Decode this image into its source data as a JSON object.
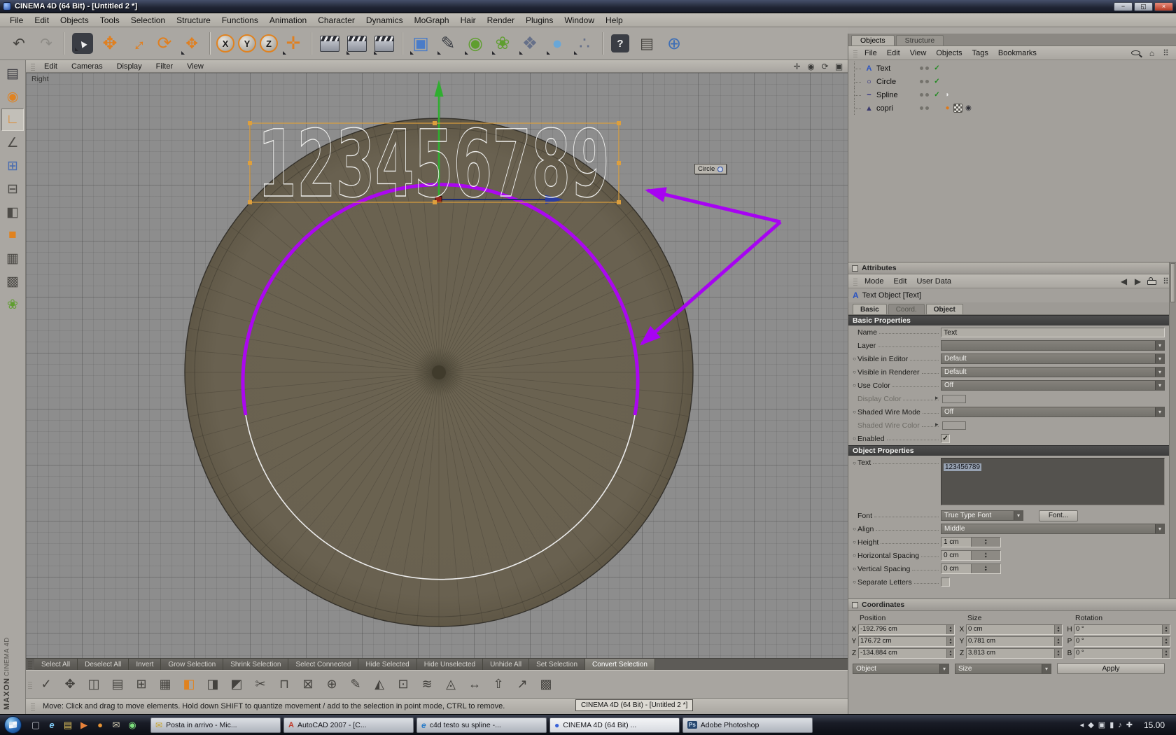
{
  "window": {
    "title": "CINEMA 4D (64 Bit) - [Untitled 2 *]",
    "minimize": "−",
    "maximize": "◱",
    "close": "×"
  },
  "menubar": {
    "items": [
      "File",
      "Edit",
      "Objects",
      "Tools",
      "Selection",
      "Structure",
      "Functions",
      "Animation",
      "Character",
      "Dynamics",
      "MoGraph",
      "Hair",
      "Render",
      "Plugins",
      "Window",
      "Help"
    ]
  },
  "toolbar": {
    "icons": [
      {
        "name": "undo-icon",
        "glyph": "↶",
        "cls": "t-plain"
      },
      {
        "name": "redo-icon",
        "glyph": "↷",
        "cls": "t-plain t-dim"
      },
      {
        "name": "toolbar-separator",
        "glyph": "",
        "cls": "t-sep"
      },
      {
        "name": "live-selection-icon",
        "glyph": "▲",
        "cls": "t-round t-fly"
      },
      {
        "name": "move-tool-icon",
        "glyph": "✥",
        "cls": "t-orange t-big"
      },
      {
        "name": "scale-tool-icon",
        "glyph": "↔",
        "cls": "t-orange t-big t-rot"
      },
      {
        "name": "rotate-tool-icon",
        "glyph": "⟳",
        "cls": "t-orange t-big"
      },
      {
        "name": "active-tool-icon",
        "glyph": "✥",
        "cls": "t-orange t-fly"
      },
      {
        "name": "toolbar-separator",
        "glyph": "",
        "cls": "t-sep"
      },
      {
        "name": "lock-x-axis-icon",
        "glyph": "X",
        "cls": "t-axis"
      },
      {
        "name": "lock-y-axis-icon",
        "glyph": "Y",
        "cls": "t-axis"
      },
      {
        "name": "lock-z-axis-icon",
        "glyph": "Z",
        "cls": "t-axis"
      },
      {
        "name": "coordinate-system-icon",
        "glyph": "✛",
        "cls": "t-orange t-big t-fly"
      },
      {
        "name": "toolbar-separator",
        "glyph": "",
        "cls": "t-sep"
      },
      {
        "name": "render-view-icon",
        "glyph": "",
        "cls": "t-clap"
      },
      {
        "name": "render-picture-viewer-icon",
        "glyph": "",
        "cls": "t-clap t-fly"
      },
      {
        "name": "render-settings-icon",
        "glyph": "",
        "cls": "t-clap t-fly"
      },
      {
        "name": "toolbar-separator",
        "glyph": "",
        "cls": "t-sep"
      },
      {
        "name": "add-cube-icon",
        "glyph": "▣",
        "cls": "t-blue t-big t-fly"
      },
      {
        "name": "add-spline-icon",
        "glyph": "✎",
        "cls": "t-pen t-big t-fly"
      },
      {
        "name": "add-nurbs-icon",
        "glyph": "◉",
        "cls": "t-green t-big t-fly"
      },
      {
        "name": "add-modeling-icon",
        "glyph": "❀",
        "cls": "t-green t-big t-fly"
      },
      {
        "name": "add-deformer-icon",
        "glyph": "❖",
        "cls": "t-slate t-big t-fly"
      },
      {
        "name": "add-environment-icon",
        "glyph": "●",
        "cls": "t-sky t-big t-fly"
      },
      {
        "name": "add-particles-icon",
        "glyph": "∴",
        "cls": "t-slate t-big t-fly"
      },
      {
        "name": "toolbar-separator",
        "glyph": "",
        "cls": "t-sep"
      },
      {
        "name": "help-icon",
        "glyph": "?",
        "cls": "t-help"
      },
      {
        "name": "tablet-icon",
        "glyph": "▤",
        "cls": "t-plain"
      },
      {
        "name": "browser-icon",
        "glyph": "⊕",
        "cls": "t-globe"
      }
    ]
  },
  "left_palette": {
    "icons": [
      {
        "name": "display-filter-icon",
        "glyph": "▤",
        "cls": "c-dark"
      },
      {
        "name": "object-mode-icon",
        "glyph": "◉",
        "cls": "c-orange"
      },
      {
        "name": "model-mode-icon",
        "glyph": "∟",
        "cls": "c-orange p-active"
      },
      {
        "name": "object-axis-mode-icon",
        "glyph": "∠",
        "cls": "c-gray"
      },
      {
        "name": "point-mode-icon",
        "glyph": "⊞",
        "cls": "c-blue"
      },
      {
        "name": "edge-mode-icon",
        "glyph": "⊟",
        "cls": "c-gray"
      },
      {
        "name": "polygon-mode-icon",
        "glyph": "◧",
        "cls": "c-gray"
      },
      {
        "name": "texture-mode-icon",
        "glyph": "■",
        "cls": "c-orange"
      },
      {
        "name": "texture-axis-mode-icon",
        "glyph": "▦",
        "cls": "c-gray"
      },
      {
        "name": "workplane-icon",
        "glyph": "▩",
        "cls": "c-gray"
      },
      {
        "name": "kinematics-icon",
        "glyph": "❀",
        "cls": "c-green"
      }
    ]
  },
  "branding": {
    "line1": "MAXON",
    "line2": "CINEMA 4D"
  },
  "viewport": {
    "menu": [
      "Edit",
      "Cameras",
      "Display",
      "Filter",
      "View"
    ],
    "corner_icons": [
      {
        "name": "pan-view-icon",
        "glyph": "✛",
        "cls": ""
      },
      {
        "name": "zoom-view-icon",
        "glyph": "◉",
        "cls": ""
      },
      {
        "name": "rotate-view-icon",
        "glyph": "⟳",
        "cls": ""
      },
      {
        "name": "toggle-view-icon",
        "glyph": "▣",
        "cls": ""
      }
    ],
    "view_label": "Right",
    "spline_text": "123456789",
    "tooltip": {
      "label": "Circle"
    }
  },
  "object_manager": {
    "tabs": [
      {
        "name": "tab-objects",
        "label": "Objects",
        "cls": "on"
      },
      {
        "name": "tab-structure",
        "label": "Structure",
        "cls": ""
      }
    ],
    "menu": [
      "File",
      "Edit",
      "View",
      "Objects",
      "Tags",
      "Bookmarks"
    ],
    "corner_icons": [
      {
        "name": "search-icon",
        "glyph": "",
        "cls": "css-search"
      },
      {
        "name": "home-icon",
        "glyph": "⌂",
        "cls": ""
      },
      {
        "name": "panel-menu-icon",
        "glyph": "⠿",
        "cls": ""
      }
    ],
    "objects": [
      {
        "name": "Text",
        "icon_name": "text-spline-icon",
        "icon": "ico-text",
        "ig": "A",
        "check": "✓"
      },
      {
        "name": "Circle",
        "icon_name": "circle-spline-icon",
        "icon": "ico-circle",
        "ig": "○",
        "check": "✓"
      },
      {
        "name": "Spline",
        "icon_name": "spline-icon",
        "icon": "ico-spline",
        "ig": "~",
        "check": "✓",
        "tag1": "◗",
        "tag1c": "tag-white"
      },
      {
        "name": "copri",
        "icon_name": "polygon-object-icon",
        "icon": "ico-poly",
        "ig": "▲",
        "check": "",
        "tag1": "●",
        "tag1c": "tag-orange",
        "tag2": "",
        "tag2c": "tag-checker",
        "tag3": "◉",
        "tag3c": "tag-dark"
      }
    ]
  },
  "attributes": {
    "panel_title": "Attributes",
    "menu": [
      "Mode",
      "Edit",
      "User Data"
    ],
    "nav_icons": [
      {
        "name": "prev-object-icon",
        "glyph": "◀",
        "cls": ""
      },
      {
        "name": "next-object-icon",
        "glyph": "▶",
        "cls": ""
      },
      {
        "name": "lock-icon",
        "glyph": "",
        "cls": "css-lock"
      },
      {
        "name": "panel-menu-icon",
        "glyph": "⠿",
        "cls": ""
      }
    ],
    "object_header": {
      "icon": "A",
      "title": "Text Object [Text]"
    },
    "tabs": [
      {
        "name": "tab-basic",
        "label": "Basic",
        "cls": "on"
      },
      {
        "name": "tab-coord",
        "label": "Coord.",
        "cls": "dim"
      },
      {
        "name": "tab-object",
        "label": "Object",
        "cls": "on"
      }
    ],
    "sections": {
      "basic": "Basic Properties",
      "object": "Object Properties"
    },
    "basic_rows": [
      {
        "type": "text",
        "label": "Name",
        "value": "Text"
      },
      {
        "type": "dd",
        "label": "Layer",
        "value": ""
      },
      {
        "type": "dd",
        "label": "Visible in Editor",
        "value": "Default",
        "dotcls": "on"
      },
      {
        "type": "dd",
        "label": "Visible in Renderer",
        "value": "Default",
        "dotcls": "on"
      },
      {
        "type": "dd",
        "label": "Use Color",
        "value": "Off",
        "dotcls": "on"
      },
      {
        "type": "color",
        "label": "Display Color",
        "value": "",
        "lblcls": "muted"
      },
      {
        "type": "dd",
        "label": "Shaded Wire Mode",
        "value": "Off",
        "dotcls": "on"
      },
      {
        "type": "color",
        "label": "Shaded Wire Color",
        "value": "",
        "lblcls": "muted"
      },
      {
        "type": "check",
        "label": "Enabled",
        "value": "✓",
        "dotcls": "on"
      }
    ],
    "text_row": {
      "label": "Text",
      "value": "123456789"
    },
    "font_row": {
      "label": "Font",
      "dropdown": "True Type Font",
      "button": "Font..."
    },
    "object_rows": [
      {
        "type": "dd",
        "label": "Align",
        "value": "Middle",
        "dotcls": "on"
      },
      {
        "type": "num",
        "label": "Height",
        "value": "1 cm",
        "dotcls": "on"
      },
      {
        "type": "num",
        "label": "Horizontal Spacing",
        "value": "0 cm",
        "dotcls": "on"
      },
      {
        "type": "num",
        "label": "Vertical Spacing",
        "value": "0 cm",
        "dotcls": "on"
      },
      {
        "type": "check",
        "label": "Separate Letters",
        "value": "",
        "dotcls": "on"
      }
    ]
  },
  "coordinates": {
    "panel_title": "Coordinates",
    "headers": [
      "Position",
      "Size",
      "Rotation"
    ],
    "position": [
      {
        "axis": "X",
        "value": "-192.796 cm"
      },
      {
        "axis": "Y",
        "value": "176.72 cm"
      },
      {
        "axis": "Z",
        "value": "-134.884 cm"
      }
    ],
    "size": [
      {
        "axis": "X",
        "value": "0 cm"
      },
      {
        "axis": "Y",
        "value": "0.781 cm"
      },
      {
        "axis": "Z",
        "value": "3.813 cm"
      }
    ],
    "rotation": [
      {
        "axis": "H",
        "value": "0 °"
      },
      {
        "axis": "P",
        "value": "0 °"
      },
      {
        "axis": "B",
        "value": "0 °"
      }
    ],
    "footer": {
      "left_dropdown": "Object",
      "mid_dropdown": "Size",
      "apply": "Apply"
    }
  },
  "selection_bar": {
    "items": [
      {
        "name": "select-all-button",
        "label": "Select All"
      },
      {
        "name": "deselect-all-button",
        "label": "Deselect All"
      },
      {
        "name": "invert-button",
        "label": "Invert"
      },
      {
        "name": "grow-selection-button",
        "label": "Grow Selection"
      },
      {
        "name": "shrink-selection-button",
        "label": "Shrink Selection"
      },
      {
        "name": "select-connected-button",
        "label": "Select Connected"
      },
      {
        "name": "hide-selected-button",
        "label": "Hide Selected"
      },
      {
        "name": "hide-unselected-button",
        "label": "Hide Unselected"
      },
      {
        "name": "unhide-all-button",
        "label": "Unhide All"
      },
      {
        "name": "set-selection-button",
        "label": "Set Selection"
      },
      {
        "name": "convert-selection-button",
        "label": "Convert Selection",
        "cls": "on"
      }
    ]
  },
  "modeling_bar": {
    "icons": [
      {
        "name": "snap-settings-icon",
        "glyph": "✓"
      },
      {
        "name": "move-points-icon",
        "glyph": "✥"
      },
      {
        "name": "mirror-icon",
        "glyph": "◫"
      },
      {
        "name": "array-icon",
        "glyph": "▤"
      },
      {
        "name": "clone-icon",
        "glyph": "⊞"
      },
      {
        "name": "subdivide-icon",
        "glyph": "▦"
      },
      {
        "name": "extrude-icon",
        "glyph": "◧",
        "cls": "c-orange"
      },
      {
        "name": "inner-extrude-icon",
        "glyph": "◨"
      },
      {
        "name": "bevel-icon",
        "glyph": "◩"
      },
      {
        "name": "knife-icon",
        "glyph": "✂"
      },
      {
        "name": "bridge-icon",
        "glyph": "⊓"
      },
      {
        "name": "close-hole-icon",
        "glyph": "⊠"
      },
      {
        "name": "weld-icon",
        "glyph": "⊕"
      },
      {
        "name": "brush-icon",
        "glyph": "✎"
      },
      {
        "name": "magnet-icon",
        "glyph": "◭"
      },
      {
        "name": "iron-icon",
        "glyph": "⊡"
      },
      {
        "name": "stitch-icon",
        "glyph": "≋"
      },
      {
        "name": "edge-cut-icon",
        "glyph": "◬"
      },
      {
        "name": "slide-icon",
        "glyph": "↔"
      },
      {
        "name": "smooth-shift-icon",
        "glyph": "⇧"
      },
      {
        "name": "normal-move-icon",
        "glyph": "↗"
      },
      {
        "name": "matrix-extrude-icon",
        "glyph": "▩"
      }
    ]
  },
  "status": {
    "message": "Move: Click and drag to move elements. Hold down SHIFT to quantize movement / add to the selection in point mode, CTRL to remove.",
    "tooltip": "CINEMA 4D (64 Bit) - [Untitled 2 *]"
  },
  "taskbar": {
    "quick_launch": [
      {
        "name": "show-desktop-icon",
        "glyph": "▢",
        "cls": "q-gray"
      },
      {
        "name": "ie-icon",
        "glyph": "e",
        "cls": "q-ie"
      },
      {
        "name": "explorer-icon",
        "glyph": "▤",
        "cls": "q-folder"
      },
      {
        "name": "media-player-icon",
        "glyph": "▶",
        "cls": "q-media"
      },
      {
        "name": "firefox-icon",
        "glyph": "●",
        "cls": "q-ff"
      },
      {
        "name": "mail-icon",
        "glyph": "✉",
        "cls": "q-mail"
      },
      {
        "name": "messenger-icon",
        "glyph": "◉",
        "cls": "q-msn"
      }
    ],
    "tasks": [
      {
        "name": "task-outlook",
        "icon": "✉",
        "icls": "ti-mail",
        "label": "Posta in arrivo - Mic...",
        "cls": ""
      },
      {
        "name": "task-autocad",
        "icon": "A",
        "icls": "ti-acad",
        "label": "AutoCAD 2007 - [C...",
        "cls": ""
      },
      {
        "name": "task-ie",
        "icon": "e",
        "icls": "ti-ie",
        "label": "c4d testo su spline -...",
        "cls": ""
      },
      {
        "name": "task-c4d",
        "icon": "●",
        "icls": "ti-c4d",
        "label": "CINEMA 4D (64 Bit) ...",
        "cls": "on"
      },
      {
        "name": "task-photoshop",
        "icon": "Ps",
        "icls": "ti-ps",
        "label": "Adobe Photoshop",
        "cls": ""
      }
    ],
    "tray_icons": [
      {
        "name": "tray-expand-icon",
        "glyph": "◂"
      },
      {
        "name": "tray-app-icon",
        "glyph": "◆"
      },
      {
        "name": "tray-display-icon",
        "glyph": "▣"
      },
      {
        "name": "tray-network-icon",
        "glyph": "▮"
      },
      {
        "name": "tray-volume-icon",
        "glyph": "♪"
      },
      {
        "name": "tray-shield-icon",
        "glyph": "✚"
      }
    ],
    "clock": "15.00"
  }
}
